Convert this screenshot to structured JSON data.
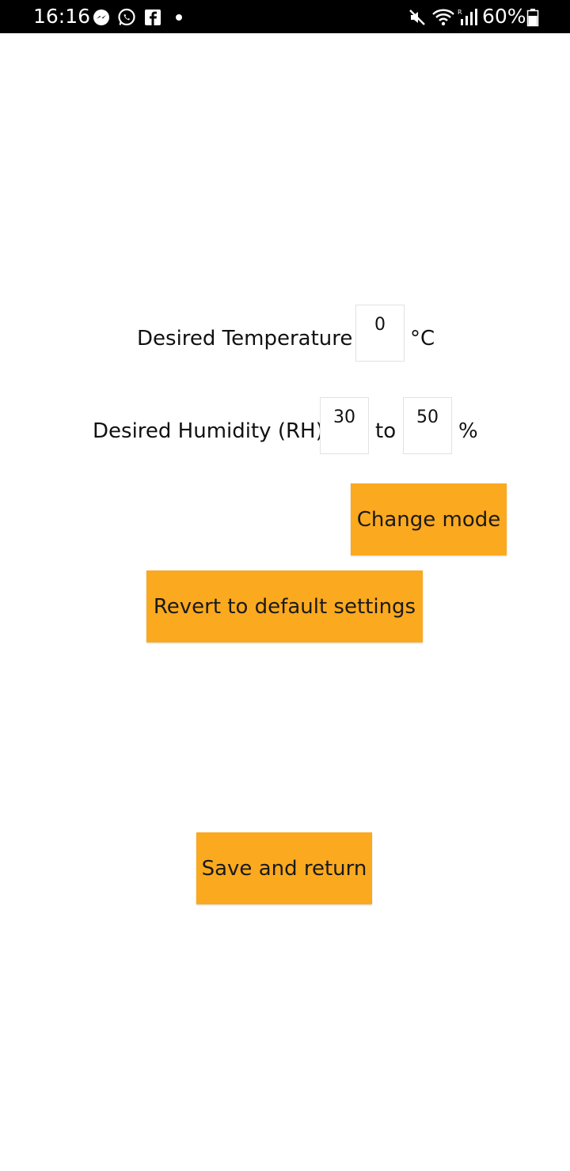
{
  "status_bar": {
    "time": "16:16",
    "battery": "60%",
    "notification_icons": [
      "messenger-icon",
      "whatsapp-icon",
      "facebook-icon",
      "dot-icon"
    ],
    "system_icons": [
      "mute-icon",
      "wifi-icon",
      "signal-icon",
      "battery-icon"
    ]
  },
  "temperature": {
    "label": "Desired Temperature",
    "value": "0",
    "unit": "°C"
  },
  "humidity": {
    "label": "Desired Humidity (RH)",
    "min_value": "30",
    "separator": "to",
    "max_value": "50",
    "unit": "%"
  },
  "buttons": {
    "change_mode": "Change mode",
    "revert": "Revert to default settings",
    "save": "Save and return"
  },
  "colors": {
    "button_bg": "#FBA91F",
    "status_bar_bg": "#000000"
  }
}
